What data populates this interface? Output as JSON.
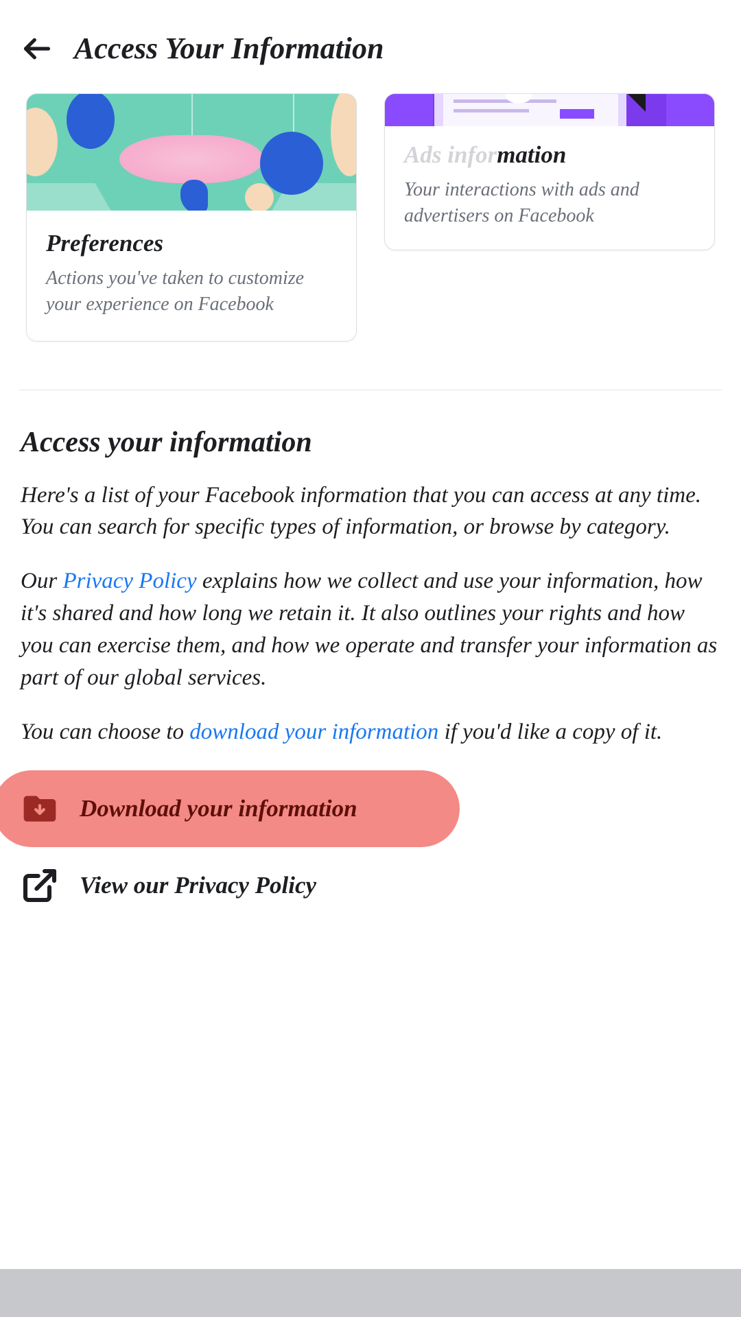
{
  "header": {
    "title": "Access Your Information"
  },
  "cards": {
    "preferences": {
      "title": "Preferences",
      "desc": "Actions you've taken to customize your experience on Facebook"
    },
    "ads": {
      "title": "Ads information",
      "desc": "Your interactions with ads and advertisers on Facebook"
    }
  },
  "info": {
    "heading": "Access your information",
    "p1": "Here's a list of your Facebook information that you can access at any time. You can search for specific types of information, or browse by category.",
    "p2_prefix": "Our ",
    "p2_link": "Privacy Policy",
    "p2_rest": " explains how we collect and use your information, how it's shared and how long we retain it. It also outlines your rights and how you can exercise them, and how we operate and transfer your information as part of our global services.",
    "p3_prefix": "You can choose to ",
    "p3_link": "download your information",
    "p3_rest": " if you'd like a copy of it."
  },
  "actions": {
    "download": "Download your information",
    "privacy": "View our Privacy Policy"
  }
}
